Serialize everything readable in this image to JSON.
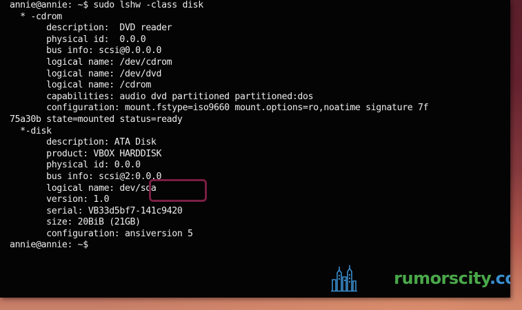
{
  "terminal": {
    "lines": [
      "annie@annie: ~$ sudo lshw -class disk",
      "  * -cdrom",
      "       description:  DVD reader",
      "       physical id:  0.0.0",
      "       bus info: scsi@0.0.0.0",
      "       logical name: /dev/cdrom",
      "       logical name: /dev/dvd",
      "       logical name: /cdrom",
      "       capabilities: audio dvd partitioned partitioned:dos",
      "       configuration: mount.fstype=iso9660 mount.options=ro,noatime signature 7f",
      "75a30b state=mounted status=ready",
      "  *-disk",
      "       description: ATA Disk",
      "       product: VBOX HARDDISK",
      "       physical id: 0.0.0",
      "       bus info: scsi@2:0.0.0",
      "       logical name: dev/sda",
      "       version: 1.0",
      "       serial: VB33d5bf7-141c9420",
      "       size: 20BiB (21GB)",
      "       configuration: ansiversion 5",
      "annie@annie: ~$"
    ]
  },
  "watermark": {
    "text_main": "rumorscity",
    "text_domain": ".com",
    "logo_icon": "city-skyline-icon"
  },
  "colors": {
    "terminal_bg": "#040404",
    "terminal_text": "#ececec",
    "highlight_border": "#7a1e44",
    "desktop_bg": "#6e2432",
    "watermark_green": "#4aa84a",
    "watermark_blue": "#3a8fd0"
  }
}
